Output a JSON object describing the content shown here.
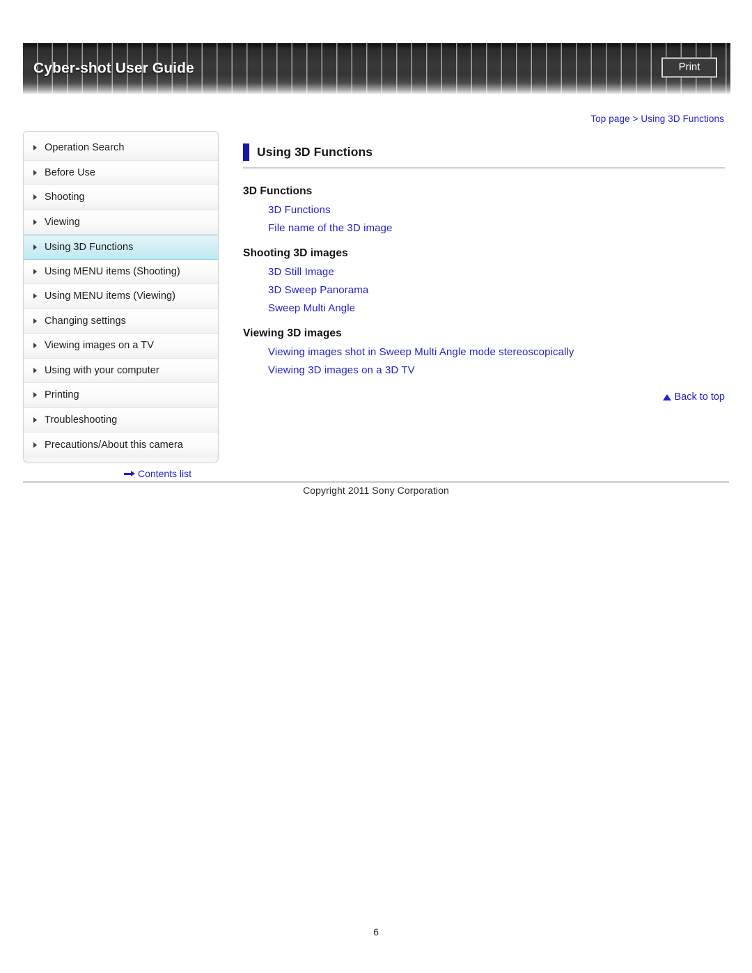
{
  "header": {
    "title": "Cyber-shot User Guide",
    "print_label": "Print"
  },
  "breadcrumb": {
    "top": "Top page",
    "separator": ">",
    "current": "Using 3D Functions"
  },
  "sidebar": {
    "items": [
      {
        "label": "Operation Search",
        "selected": false
      },
      {
        "label": "Before Use",
        "selected": false
      },
      {
        "label": "Shooting",
        "selected": false
      },
      {
        "label": "Viewing",
        "selected": false
      },
      {
        "label": "Using 3D Functions",
        "selected": true
      },
      {
        "label": "Using MENU items (Shooting)",
        "selected": false
      },
      {
        "label": "Using MENU items (Viewing)",
        "selected": false
      },
      {
        "label": "Changing settings",
        "selected": false
      },
      {
        "label": "Viewing images on a TV",
        "selected": false
      },
      {
        "label": "Using with your computer",
        "selected": false
      },
      {
        "label": "Printing",
        "selected": false
      },
      {
        "label": "Troubleshooting",
        "selected": false
      },
      {
        "label": "Precautions/About this camera",
        "selected": false
      }
    ],
    "contents_list_label": "Contents list"
  },
  "main": {
    "page_title": "Using 3D Functions",
    "sections": [
      {
        "heading": "3D Functions",
        "links": [
          "3D Functions",
          "File name of the 3D image"
        ]
      },
      {
        "heading": "Shooting 3D images",
        "links": [
          "3D Still Image",
          "3D Sweep Panorama",
          "Sweep Multi Angle"
        ]
      },
      {
        "heading": "Viewing 3D images",
        "links": [
          "Viewing images shot in Sweep Multi Angle mode stereoscopically",
          "Viewing 3D images on a 3D TV"
        ]
      }
    ],
    "back_to_top_label": "Back to top"
  },
  "footer": {
    "copyright": "Copyright 2011 Sony Corporation",
    "page_number": "6"
  },
  "colors": {
    "link_blue": "#2222c8",
    "title_accent": "#1818a8",
    "selected_nav": "#cfeef5"
  }
}
